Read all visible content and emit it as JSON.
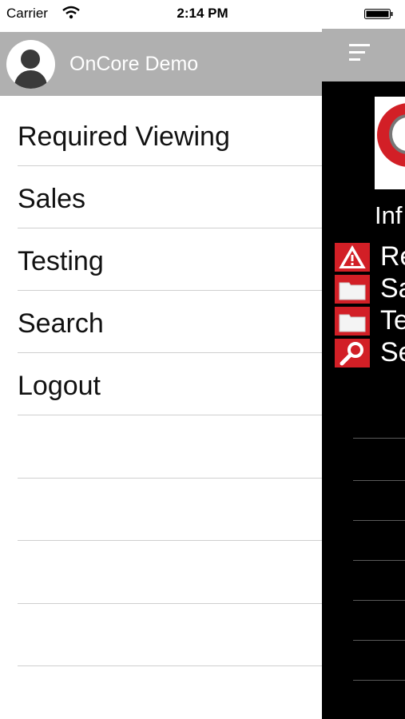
{
  "status": {
    "carrier": "Carrier",
    "time": "2:14 PM"
  },
  "drawer": {
    "user_name": "OnCore Demo",
    "items": [
      {
        "label": "Required Viewing"
      },
      {
        "label": "Sales"
      },
      {
        "label": "Testing"
      },
      {
        "label": "Search"
      },
      {
        "label": "Logout"
      }
    ]
  },
  "main": {
    "info_text": "Inf",
    "rows": [
      {
        "icon": "warning-icon",
        "label": "Re"
      },
      {
        "icon": "folder-icon",
        "label": "Sa"
      },
      {
        "icon": "folder-icon",
        "label": "Te"
      },
      {
        "icon": "search-icon",
        "label": "Se"
      }
    ]
  },
  "colors": {
    "header_gray": "#b0b0b0",
    "accent_red": "#d21f26",
    "background_black": "#000000"
  }
}
